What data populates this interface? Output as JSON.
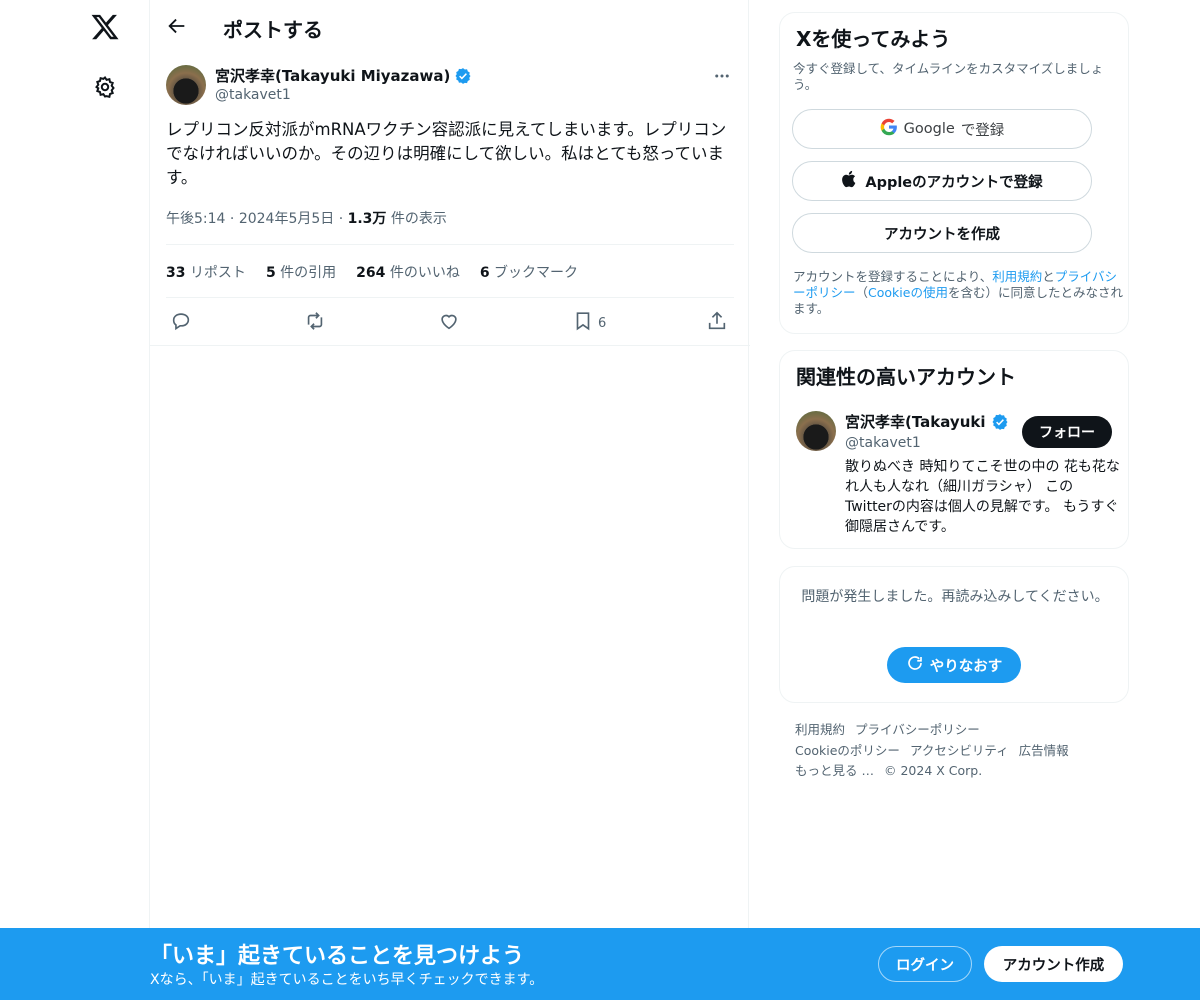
{
  "nav": {
    "logo_icon": "x-logo-icon",
    "settings_icon": "gear-icon"
  },
  "header": {
    "title": "ポストする"
  },
  "post": {
    "author_name": "宮沢孝幸(Takayuki Miyazawa)",
    "handle": "@takavet1",
    "text": "レプリコン反対派がmRNAワクチン容認派に見えてしまいます。レプリコンでなければいいのか。その辺りは明確にして欲しい。私はとても怒っています。",
    "time": "午後5:14",
    "date": "2024年5月5日",
    "views_value": "1.3万",
    "views_label": "件の表示",
    "stats": {
      "reposts_value": "33",
      "reposts_label": "リポスト",
      "quotes_value": "5",
      "quotes_label": "件の引用",
      "likes_value": "264",
      "likes_label": "件のいいね",
      "bookmarks_value": "6",
      "bookmarks_label": "ブックマーク"
    },
    "bookmark_count": "6"
  },
  "signup": {
    "title": "Xを使ってみよう",
    "subtitle": "今すぐ登録して、タイムラインをカスタマイズしましょう。",
    "google_label": "Google",
    "google_suffix": "で登録",
    "apple_label": "Appleのアカウントで登録",
    "create_label": "アカウントを作成",
    "legal_prefix": "アカウントを登録することにより、",
    "legal_terms": "利用規約",
    "legal_and": "と",
    "legal_privacy": "プライバシーポリシー",
    "legal_open": "（",
    "legal_cookie": "Cookieの使用",
    "legal_suffix": "を含む）に同意したとみなされます。"
  },
  "related": {
    "title": "関連性の高いアカウント",
    "name": "宮沢孝幸(Takayuki Miyazawa)",
    "handle": "@takavet1",
    "follow_label": "フォロー",
    "bio": "散りぬべき 時知りてこそ世の中の 花も花なれ人も人なれ（細川ガラシャ） このTwitterの内容は個人の見解です。 もうすぐ御隠居さんです。"
  },
  "error": {
    "message": "問題が発生しました。再読み込みしてください。",
    "retry_label": "やりなおす"
  },
  "footer": {
    "links": [
      "利用規約",
      "プライバシーポリシー",
      "Cookieのポリシー",
      "アクセシビリティ",
      "広告情報",
      "もっと見る …",
      "© 2024 X Corp."
    ]
  },
  "bottom_bar": {
    "title": "「いま」起きていることを見つけよう",
    "subtitle": "Xなら、「いま」起きていることをいち早くチェックできます。",
    "login_label": "ログイン",
    "create_label": "アカウント作成"
  },
  "colors": {
    "accent": "#1d9bf0",
    "text": "#0f1419",
    "muted": "#536471",
    "border": "#eff3f4"
  }
}
